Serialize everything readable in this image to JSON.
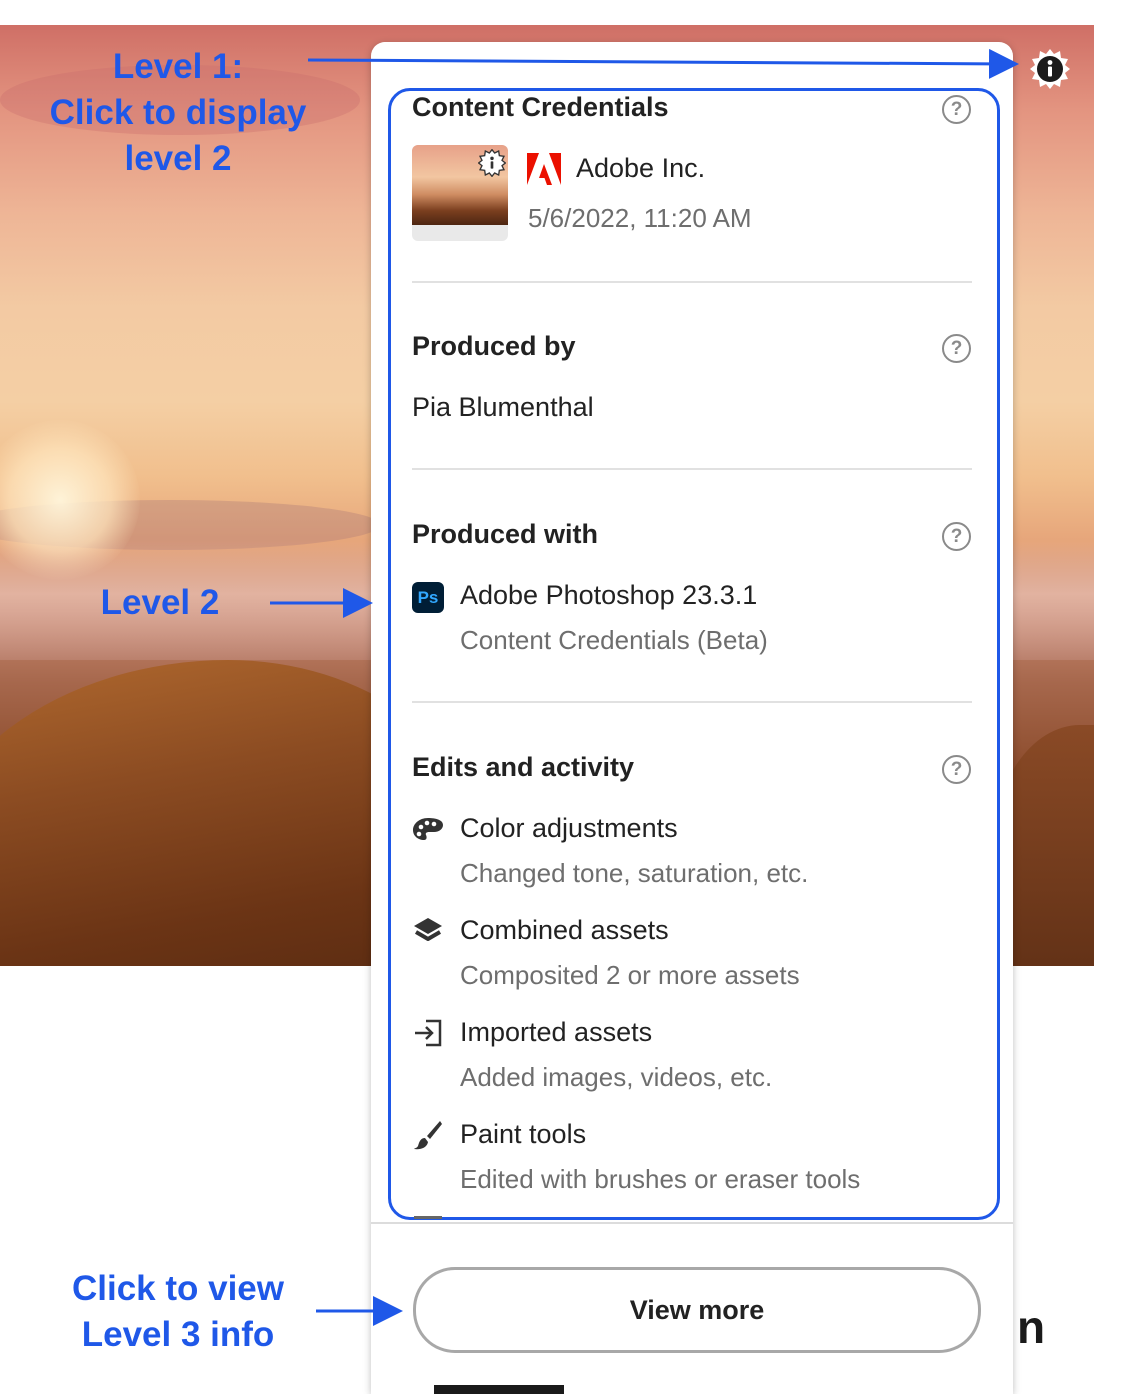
{
  "annotations": {
    "level1": "Level 1:\nClick to display\nlevel 2",
    "level2": "Level 2",
    "level3": "Click to view\nLevel 3 info"
  },
  "panel": {
    "title": "Content Credentials",
    "issuer": {
      "name": "Adobe Inc.",
      "date": "5/6/2022, 11:20 AM",
      "logo_icon": "adobe-logo-icon"
    },
    "produced_by": {
      "heading": "Produced by",
      "value": "Pia Blumenthal"
    },
    "produced_with": {
      "heading": "Produced with",
      "app_icon_label": "Ps",
      "app": "Adobe Photoshop 23.3.1",
      "detail": "Content Credentials (Beta)"
    },
    "edits": {
      "heading": "Edits and activity",
      "items": [
        {
          "icon": "palette-icon",
          "label": "Color adjustments",
          "detail": "Changed tone, saturation, etc."
        },
        {
          "icon": "layers-icon",
          "label": "Combined assets",
          "detail": "Composited 2 or more assets"
        },
        {
          "icon": "import-icon",
          "label": "Imported assets",
          "detail": "Added images, videos, etc."
        },
        {
          "icon": "brush-icon",
          "label": "Paint tools",
          "detail": "Edited with brushes or eraser tools"
        }
      ]
    },
    "view_more": "View more"
  },
  "page_fragment": "n",
  "colors": {
    "annotation_blue": "#1f58e8",
    "adobe_red": "#eb1000",
    "ps_navy": "#001e36",
    "ps_blue": "#31a8ff"
  }
}
